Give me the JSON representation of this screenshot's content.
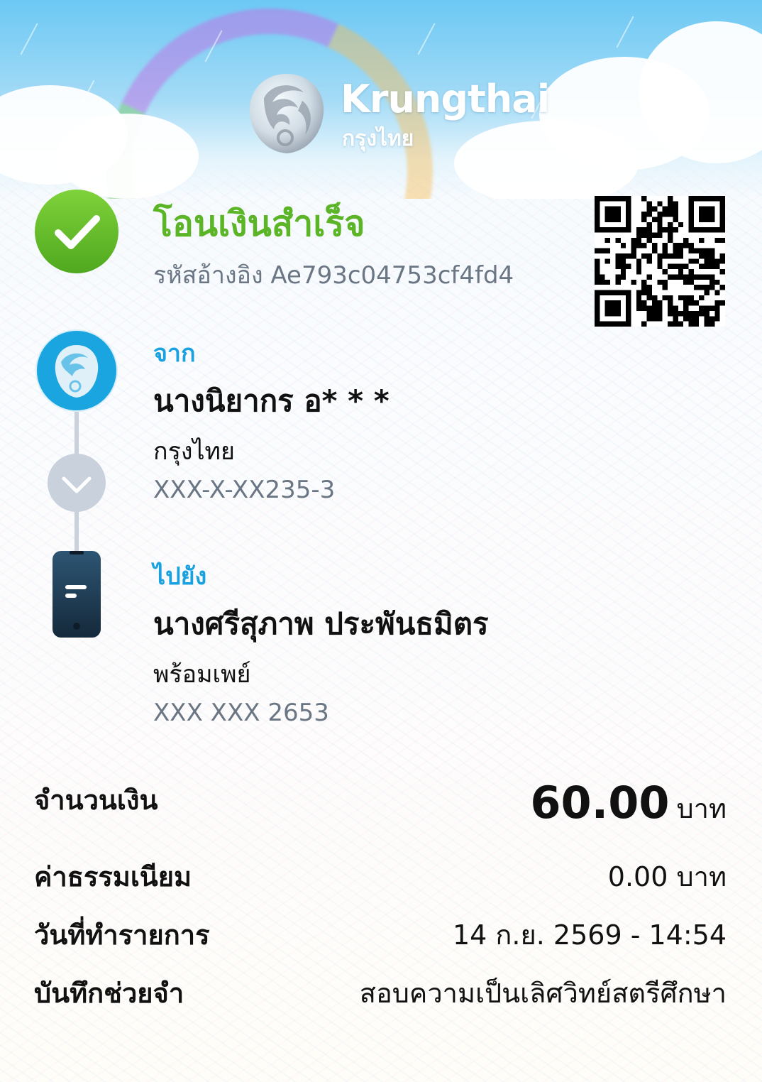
{
  "brand": {
    "name_en": "Krungthai",
    "name_th": "กรุงไทย"
  },
  "status": {
    "title": "โอนเงินสำเร็จ",
    "reference": "รหัสอ้างอิง Ae793c04753cf4fd4"
  },
  "from": {
    "label": "จาก",
    "name": "นางนิยากร อ* * *",
    "bank": "กรุงไทย",
    "account": "XXX-X-XX235-3"
  },
  "to": {
    "label": "ไปยัง",
    "name": "นางศรีสุภาพ ประพันธมิตร",
    "bank": "พร้อมเพย์",
    "account": "XXX XXX 2653"
  },
  "details": {
    "amount_label": "จำนวนเงิน",
    "amount_value": "60.00",
    "amount_unit": "บาท",
    "fee_label": "ค่าธรรมเนียม",
    "fee_value": "0.00 บาท",
    "date_label": "วันที่ทำรายการ",
    "date_value": "14 ก.ย. 2569 - 14:54",
    "memo_label": "บันทึกช่วยจำ",
    "memo_value": "สอบความเป็นเลิศวิทย์สตรีศึกษา"
  },
  "colors": {
    "success_green": "#5bb527",
    "label_blue": "#1aa1df",
    "muted_gray": "#6a7684",
    "krungthai_blue": "#1ba5e0",
    "promptpay_navy": "#1d3a52"
  },
  "icons": [
    "check-circle-icon",
    "krungthai-logo-icon",
    "chevron-down-icon",
    "mobile-phone-icon",
    "qr-code-icon"
  ]
}
